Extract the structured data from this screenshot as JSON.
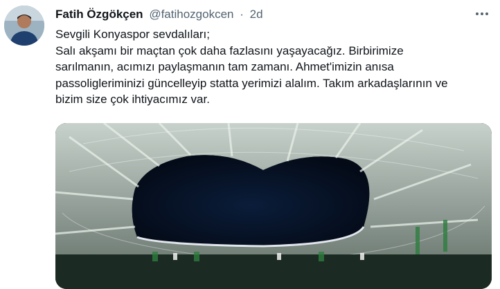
{
  "tweet": {
    "display_name": "Fatih Özgökçen",
    "handle": "@fatihozgokcen",
    "separator": "·",
    "time": "2d",
    "text_lines": [
      "Sevgili Konyaspor sevdalıları;",
      "Salı akşamı bir maçtan çok daha fazlasını yaşayacağız. Birbirimize",
      "sarılmanın, acımızı paylaşmanın tam zamanı. Ahmet'imizin anısa",
      "passoligleriminizi güncelleyip statta yerimizi alalım. Takım arkadaşlarının ve",
      "bizim size çok ihtiyacımız var."
    ]
  },
  "icons": {
    "more": "more-horizontal-icon",
    "avatar": "profile-photo"
  },
  "colors": {
    "text": "#0f1419",
    "muted": "#536471",
    "background": "#ffffff"
  }
}
